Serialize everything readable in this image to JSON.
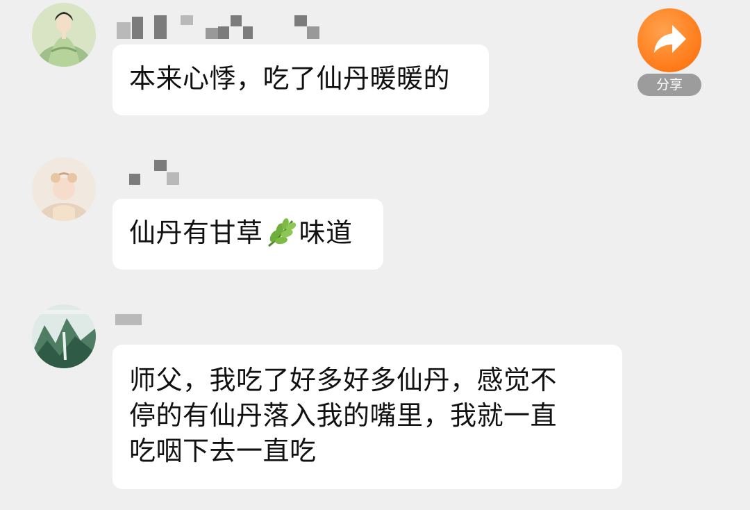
{
  "share": {
    "label": "分享",
    "icon": "share-arrow-icon",
    "color": "#ff7a18"
  },
  "messages": [
    {
      "avatar": "avatar-woman-painting",
      "text_lines": [
        "本来心悸，吃了仙丹暖暖的"
      ]
    },
    {
      "avatar": "avatar-figure-photo",
      "text_before_emoji": "仙丹有甘草",
      "emoji": "herb-leaf-icon",
      "text_after_emoji": "味道"
    },
    {
      "avatar": "avatar-landscape",
      "text_lines": [
        "师父，我吃了好多好多仙丹，感觉不",
        "停的有仙丹落入我的嘴里，我就一直",
        "吃咽下去一直吃"
      ]
    }
  ]
}
